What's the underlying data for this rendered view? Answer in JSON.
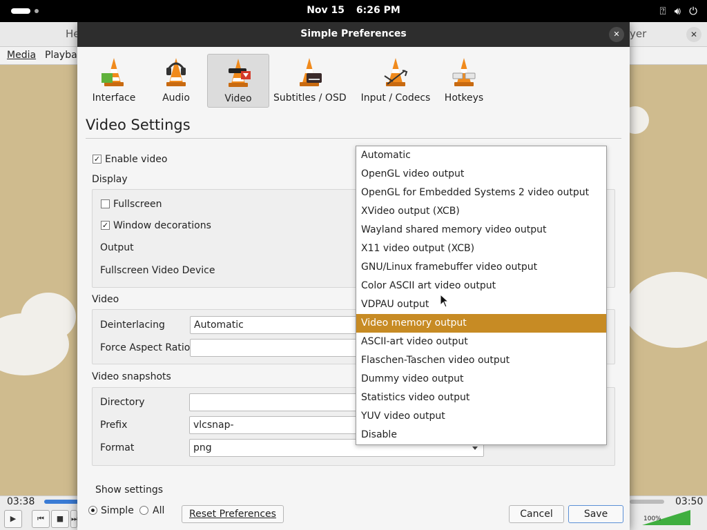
{
  "topbar": {
    "date": "Nov 15",
    "time": "6:26 PM",
    "icons": [
      "accessibility-icon",
      "volume-icon",
      "power-icon"
    ]
  },
  "vlc_main": {
    "title_left": "He",
    "title_right": "yer",
    "menu": [
      "Media",
      "Playba"
    ],
    "time_elapsed": "03:38",
    "time_total": "03:50",
    "volume": "100%"
  },
  "dialog": {
    "title": "Simple Preferences",
    "categories": [
      {
        "label": "Interface",
        "icon": "interface-cone-icon"
      },
      {
        "label": "Audio",
        "icon": "audio-cone-icon"
      },
      {
        "label": "Video",
        "icon": "video-cone-icon"
      },
      {
        "label": "Subtitles / OSD",
        "icon": "subtitles-cone-icon"
      },
      {
        "label": "Input / Codecs",
        "icon": "input-cone-icon"
      },
      {
        "label": "Hotkeys",
        "icon": "hotkeys-cone-icon"
      }
    ],
    "selected_category": "Video",
    "section_title": "Video Settings",
    "enable_video": {
      "label": "Enable video",
      "checked": true
    },
    "display": {
      "heading": "Display",
      "fullscreen": {
        "label": "Fullscreen",
        "checked": false
      },
      "window_decorations": {
        "label": "Window decorations",
        "checked": true
      },
      "output_label": "Output",
      "fullscreen_device_label": "Fullscreen Video Device"
    },
    "video": {
      "heading": "Video",
      "deinterlacing_label": "Deinterlacing",
      "deinterlacing_value": "Automatic",
      "aspect_label": "Force Aspect Ratio",
      "aspect_value": ""
    },
    "snapshots": {
      "heading": "Video snapshots",
      "directory_label": "Directory",
      "directory_value": "",
      "prefix_label": "Prefix",
      "prefix_value": "vlcsnap-",
      "format_label": "Format",
      "format_value": "png"
    },
    "show_settings": {
      "label": "Show settings",
      "simple": "Simple",
      "all": "All",
      "selected": "Simple"
    },
    "buttons": {
      "reset": "Reset Preferences",
      "cancel": "Cancel",
      "save": "Save"
    },
    "output_dropdown": {
      "selected": "Video memory output",
      "options": [
        "Automatic",
        "OpenGL video output",
        "OpenGL for Embedded Systems 2 video output",
        "XVideo output (XCB)",
        "Wayland shared memory video output",
        "X11 video output (XCB)",
        "GNU/Linux framebuffer video output",
        "Color ASCII art video output",
        "VDPAU output",
        "Video memory output",
        "ASCII-art video output",
        "Flaschen-Taschen video output",
        "Dummy video output",
        "Statistics video output",
        "YUV video output",
        "Disable"
      ]
    }
  },
  "colors": {
    "highlight": "#c78b24",
    "titlebar": "#2d2d2d",
    "accent_cone": "#f08a1c"
  }
}
